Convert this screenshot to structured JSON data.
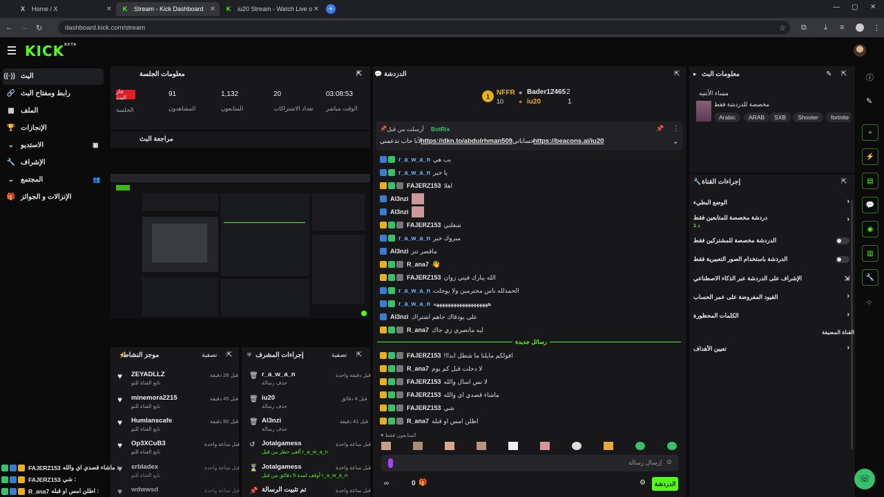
{
  "browser": {
    "tabs": [
      {
        "icon": "X",
        "label": "Home / X"
      },
      {
        "icon": "K",
        "label": "Stream - Kick Dashboard"
      },
      {
        "icon": "K",
        "label": "iu20 Stream - Watch Live on Ki..."
      }
    ],
    "url": "dashboard.kick.com/stream"
  },
  "brand": {
    "logo": "KICK",
    "beta": "BETA"
  },
  "nav": {
    "items": [
      {
        "label": "البث"
      },
      {
        "label": "رابط ومفتاح البث"
      },
      {
        "label": "الملف"
      },
      {
        "label": "الإنجازات"
      },
      {
        "label": "الاستديو"
      },
      {
        "label": "الإشراف"
      },
      {
        "label": "المجتمع"
      },
      {
        "label": "الإنزالات و الجوائز"
      }
    ]
  },
  "session": {
    "title": "معلومات الجلسة",
    "live_badge": "جار البث",
    "session_label": "الجلسة",
    "stats": [
      {
        "value": "91",
        "label": "المشاهدون"
      },
      {
        "value": "1,132",
        "label": "المتابعون"
      },
      {
        "value": "20",
        "label": "تعداد الاشتراكات"
      },
      {
        "value": "03:08:53",
        "label": "الوقت مباشر"
      }
    ]
  },
  "preview": {
    "title": "مراجعة البث"
  },
  "activity": {
    "title": "موجز النشاط",
    "filter": "تصفية",
    "items": [
      {
        "name": "ZEYADLLZ",
        "sub": "تابع القناة للتو",
        "time": "قبل 28 دقيقة"
      },
      {
        "name": "minemora2215",
        "sub": "تابع القناة للتو",
        "time": "قبل 45 دقيقة"
      },
      {
        "name": "Humlanscafe",
        "sub": "تابع القناة للتو",
        "time": "قبل 50 دقيقة"
      },
      {
        "name": "Op3XCuB3",
        "sub": "تابع القناة للتو",
        "time": "قبل ساعة واحدة"
      },
      {
        "name": "srbladex",
        "sub": "تابع القناة للتو",
        "time": "قبل ساعة واحدة"
      },
      {
        "name": "wdwwsd",
        "sub": "",
        "time": "قبل ساعة واحدة"
      }
    ]
  },
  "modactions": {
    "title": "إجراءات المشرف",
    "filter": "تصفية",
    "items": [
      {
        "name": "r_a_w_a_n",
        "sub": "حذف رسالة",
        "time": "قبل دقيقة واحدة"
      },
      {
        "name": "iu20",
        "sub": "حذف رسالة",
        "time": "قبل 4 دقائق"
      },
      {
        "name": "Al3nzi",
        "sub": "حذف رسالة",
        "time": "قبل 41 دقيقة"
      },
      {
        "name": "Jotalgamess",
        "sub": "ألغى حظر من قبل r_a_w_a_n",
        "time": "قبل ساعة واحدة"
      },
      {
        "name": "Jotalgamess",
        "sub": "أوقف لمدة 5 دقائق من قبل r_a_w_a_n",
        "time": "قبل ساعة واحدة"
      },
      {
        "name": "تم تثبيت الرسالة",
        "sub": "",
        "time": "قبل ساعة واحدة"
      }
    ]
  },
  "chat": {
    "title": "الدردشة",
    "leaders": [
      {
        "rank": "1",
        "name": "NFFR",
        "count": "10"
      },
      {
        "name": "Bader12465",
        "count": "2"
      },
      {
        "name": "iu20",
        "count": "1"
      }
    ],
    "pinned": {
      "by": "أرسلت من قبل",
      "user": "BotRix",
      "text_pre": "لأنا حاب تدعمني",
      "link1": "https://dkn.to/abdulrhman509",
      "mid": "حساباتي",
      "link2": "https://beacons.ai/iu20"
    },
    "messages": [
      {
        "user": "r_a_w_a_n",
        "text": "بب هي",
        "color": "#6fb7ff"
      },
      {
        "user": "r_a_w_a_n",
        "text": "يا خير",
        "color": "#6fb7ff"
      },
      {
        "user": "FAJERZ153",
        "text": "اهلا",
        "color": "#e9e9e9"
      },
      {
        "user": "Al3nzi",
        "text": "",
        "color": "#e9e9e9"
      },
      {
        "user": "Al3nzi",
        "text": "",
        "color": "#e9e9e9"
      },
      {
        "user": "FAJERZ153",
        "text": "شغلني",
        "color": "#e9e9e9"
      },
      {
        "user": "r_a_w_a_n",
        "text": "مبروك خير",
        "color": "#6fb7ff"
      },
      {
        "user": "Al3nzi",
        "text": "ماقصر تنز",
        "color": "#e9e9e9"
      },
      {
        "user": "R_ana7",
        "text": "",
        "color": "#e9e9e9"
      },
      {
        "user": "FAJERZ153",
        "text": "الله يبارك فيني زوان",
        "color": "#e9e9e9"
      },
      {
        "user": "r_a_w_a_n",
        "text": "الحمدلله ناس محترمين ولا يوجلت",
        "color": "#6fb7ff"
      },
      {
        "user": "r_a_w_a_n",
        "text": "هههههههههههههههههههه",
        "color": "#6fb7ff"
      },
      {
        "user": "Al3nzi",
        "text": "على بودقاك جاهم اشتراك",
        "color": "#e9e9e9"
      },
      {
        "user": "R_ana7",
        "text": "ليه ماتصري زي جاك",
        "color": "#e9e9e9"
      }
    ],
    "new_messages": "رسائل جديدة",
    "messages2": [
      {
        "user": "FAJERZ153",
        "text": "افولكم مايلنا ما شطل ابدا!!"
      },
      {
        "user": "R_ana7",
        "text": "لا دحلت قبل كم يوم"
      },
      {
        "user": "FAJERZ153",
        "text": "لا نس اسال والله"
      },
      {
        "user": "FAJERZ153",
        "text": "ماشاء قصدي اي والله"
      },
      {
        "user": "FAJERZ153",
        "text": "شي"
      },
      {
        "user": "R_ana7",
        "text": "اطلن امس او قبله"
      }
    ],
    "followers_only": "المتابعون فقط",
    "input_placeholder": "إرسال رسالة",
    "send": "الدردشة",
    "count": "0"
  },
  "overlay": {
    "lines": [
      {
        "user": "FAJERZ153",
        "text": "ماشاء قصدي اي والله :"
      },
      {
        "user": "FAJERZ153",
        "text": "شي :"
      },
      {
        "user": "R_ana7",
        "text": "اطلن امس او قبله :"
      }
    ]
  },
  "streaminfo": {
    "title": "معلومات البث",
    "stream_title": "مساء الأنتيه",
    "category_desc": "مخصصة للدردشة فقط",
    "tags": [
      "Arabic",
      "ARAB",
      "SXB",
      "Shooter",
      "fortnite"
    ]
  },
  "channel": {
    "title": "إجراءات القناة",
    "rows": [
      {
        "label": "الوضع البطيء"
      },
      {
        "label": "دردشة مخصصة للمتابعين فقط",
        "sub": "1 د"
      },
      {
        "label": "الدردشة مخصصة للمشتركين فقط"
      },
      {
        "label": "الدردشة باستخدام الصور التعبيرية فقط"
      },
      {
        "label": "الإشراف على الدردشة عبر الذكاء الاصطناعي"
      },
      {
        "label": "القيود المفروضة على عمر الحساب"
      },
      {
        "label": "الكلمات المحظورة"
      }
    ],
    "section": "القناة المضيفة",
    "goals": "تعيين الأهداف"
  }
}
